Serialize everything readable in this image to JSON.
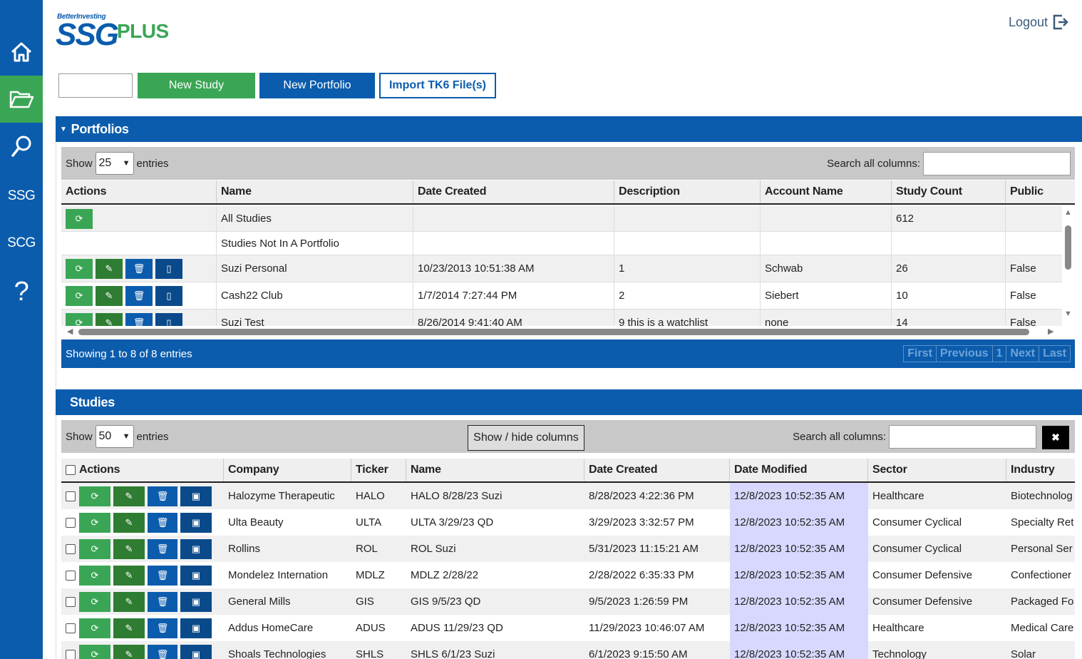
{
  "sidebar": {
    "items": [
      {
        "id": "home",
        "icon": "home-icon"
      },
      {
        "id": "portfolios",
        "icon": "folder-open-icon"
      },
      {
        "id": "search",
        "icon": "search-icon"
      },
      {
        "id": "ssg",
        "label": "SSG"
      },
      {
        "id": "scg",
        "label": "SCG"
      },
      {
        "id": "help",
        "label": "?"
      }
    ]
  },
  "header": {
    "logo_top": "BetterInvesting",
    "logo_main": "SSG",
    "logo_plus": "PLUS",
    "logout_label": "Logout"
  },
  "toolbar": {
    "new_study": "New Study",
    "new_portfolio": "New Portfolio",
    "import": "Import TK6 File(s)"
  },
  "portfolios": {
    "title": "Portfolios",
    "show_label": "Show",
    "entries_label": "entries",
    "page_size": "25",
    "search_label": "Search all columns:",
    "columns": [
      "Actions",
      "Name",
      "Date Created",
      "Description",
      "Account Name",
      "Study Count",
      "Public"
    ],
    "rows": [
      {
        "name": "All Studies",
        "date": "",
        "desc": "",
        "account": "",
        "count": "612",
        "public": ""
      },
      {
        "name": "Studies Not In A Portfolio",
        "date": "",
        "desc": "",
        "account": "",
        "count": "",
        "public": ""
      },
      {
        "name": "Suzi Personal",
        "date": "10/23/2013 10:51:38 AM",
        "desc": "1",
        "account": "Schwab",
        "count": "26",
        "public": "False"
      },
      {
        "name": "Cash22 Club",
        "date": "1/7/2014 7:27:44 PM",
        "desc": "2",
        "account": "Siebert",
        "count": "10",
        "public": "False"
      },
      {
        "name": "Suzi Test",
        "date": "8/26/2014 9:41:40 AM",
        "desc": "9 this is a watchlist",
        "account": "none",
        "count": "14",
        "public": "False"
      }
    ],
    "showing": "Showing 1 to 8 of 8 entries",
    "pager": [
      "First",
      "Previous",
      "1",
      "Next",
      "Last"
    ]
  },
  "studies": {
    "title": "Studies",
    "show_label": "Show",
    "entries_label": "entries",
    "page_size": "50",
    "show_hide": "Show / hide columns",
    "search_label": "Search all columns:",
    "clear": "✖",
    "columns": [
      "Actions",
      "Company",
      "Ticker",
      "Name",
      "Date Created",
      "Date Modified",
      "Sector",
      "Industry"
    ],
    "rows": [
      {
        "company": "Halozyme Therapeutic",
        "ticker": "HALO",
        "name": "HALO 8/28/23 Suzi",
        "created": "8/28/2023 4:22:36 PM",
        "modified": "12/8/2023 10:52:35 AM",
        "sector": "Healthcare",
        "industry": "Biotechnolog"
      },
      {
        "company": "Ulta Beauty",
        "ticker": "ULTA",
        "name": "ULTA 3/29/23 QD",
        "created": "3/29/2023 3:32:57 PM",
        "modified": "12/8/2023 10:52:35 AM",
        "sector": "Consumer Cyclical",
        "industry": "Specialty Ret"
      },
      {
        "company": "Rollins",
        "ticker": "ROL",
        "name": "ROL Suzi",
        "created": "5/31/2023 11:15:21 AM",
        "modified": "12/8/2023 10:52:35 AM",
        "sector": "Consumer Cyclical",
        "industry": "Personal Ser"
      },
      {
        "company": "Mondelez Internation",
        "ticker": "MDLZ",
        "name": "MDLZ 2/28/22",
        "created": "2/28/2022 6:35:33 PM",
        "modified": "12/8/2023 10:52:35 AM",
        "sector": "Consumer Defensive",
        "industry": "Confectioner"
      },
      {
        "company": "General Mills",
        "ticker": "GIS",
        "name": "GIS 9/5/23 QD",
        "created": "9/5/2023 1:26:59 PM",
        "modified": "12/8/2023 10:52:35 AM",
        "sector": "Consumer Defensive",
        "industry": "Packaged Fo"
      },
      {
        "company": "Addus HomeCare",
        "ticker": "ADUS",
        "name": "ADUS 11/29/23 QD",
        "created": "11/29/2023 10:46:07 AM",
        "modified": "12/8/2023 10:52:35 AM",
        "sector": "Healthcare",
        "industry": "Medical Care"
      },
      {
        "company": "Shoals Technologies",
        "ticker": "SHLS",
        "name": "SHLS 6/1/23 Suzi",
        "created": "6/1/2023 9:15:50 AM",
        "modified": "12/8/2023 10:52:35 AM",
        "sector": "Technology",
        "industry": "Solar"
      }
    ]
  },
  "colors": {
    "brand_blue": "#0b5cad",
    "brand_green": "#3aa655",
    "modified_highlight": "#d8d8ff"
  }
}
